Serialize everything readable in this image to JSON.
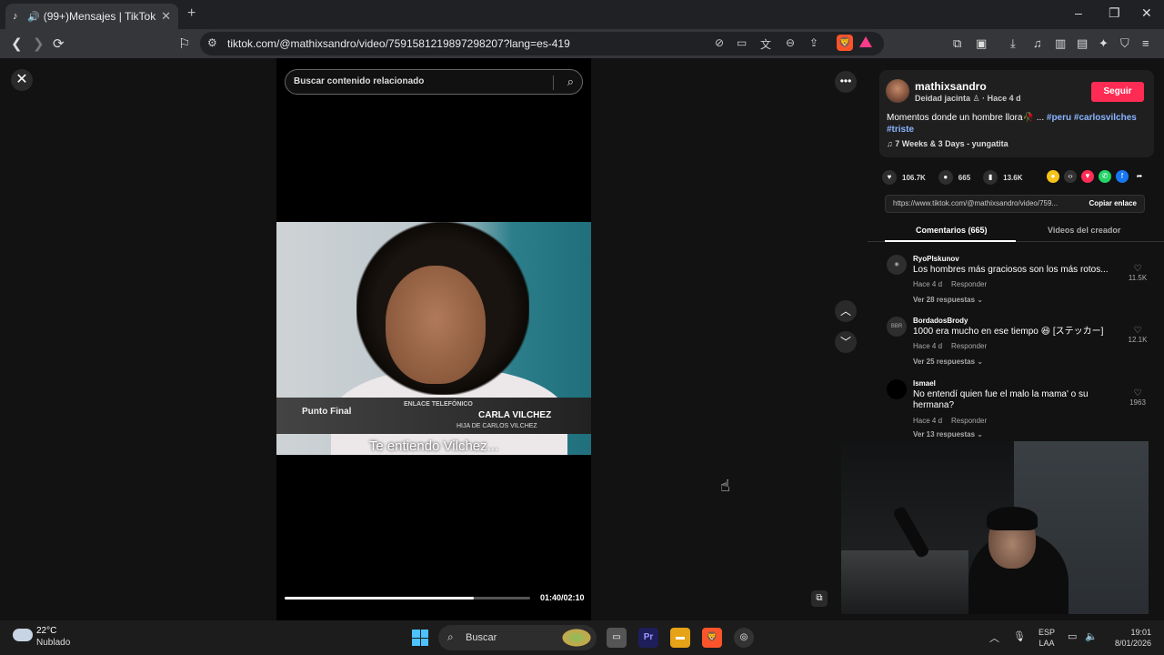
{
  "browser": {
    "tab_title": "(99+)Mensajes | TikTok",
    "url": "tiktok.com/@mathixsandro/video/7591581219897298207?lang=es-419",
    "tab_close": "✕",
    "new_tab": "+",
    "win_min": "–",
    "win_max": "❐",
    "win_close": "✕",
    "back": "❮",
    "forward": "❯",
    "reload": "⟳"
  },
  "player": {
    "search_placeholder": "Buscar contenido relacionado",
    "caption": "Te entiendo Vilchez...",
    "lower_third": {
      "logo": "Punto Final",
      "label": "ENLACE TELEFÓNICO",
      "name": "CARLA VILCHEZ",
      "subtitle": "HIJA DE CARLOS VILCHEZ"
    },
    "time": "01:40/02:10",
    "progress": 0.77
  },
  "post": {
    "author": "mathixsandro",
    "author_sub": "Deidad jacinta ♙ · Hace 4 d",
    "follow_label": "Seguir",
    "description": "Momentos donde un hombre llora🥀 ...",
    "tags": "#peru #carlosvilches #triste",
    "music": "♫ 7 Weeks & 3 Days - yungatita",
    "likes": "106.7K",
    "comments_count": "665",
    "saves": "13.6K",
    "link_url": "https://www.tiktok.com/@mathixsandro/video/759...",
    "copy_label": "Copiar enlace"
  },
  "tabs": {
    "comments": "Comentarios (665)",
    "creator_videos": "Videos del creador"
  },
  "comments": [
    {
      "user": "RyoPlskunov",
      "text": "Los hombres más graciosos son los más rotos...",
      "time": "Hace 4 d",
      "reply": "Responder",
      "replies": "Ver 28 respuestas ⌄",
      "likes": "11.5K"
    },
    {
      "user": "BordadosBrody",
      "text": "1000 era mucho en ese tiempo 😆 [ステッカー]",
      "time": "Hace 4 d",
      "reply": "Responder",
      "replies": "Ver 25 respuestas ⌄",
      "likes": "12.1K"
    },
    {
      "user": "Ismael",
      "text": "No entendí quien fue el malo la mama' o su hermana?",
      "time": "Hace 4 d",
      "reply": "Responder",
      "replies": "Ver 13 respuestas ⌄",
      "likes": "1963"
    }
  ],
  "taskbar": {
    "temp": "22°C",
    "weather": "Nublado",
    "search_label": "Buscar",
    "lang_top": "ESP",
    "lang_bottom": "LAA",
    "time": "19:01",
    "date": "8/01/2026"
  },
  "icons": {
    "close": "✕",
    "more": "•••",
    "up": "︿",
    "down": "﹀",
    "search": "⌕",
    "heart": "♥",
    "comment": "💬",
    "bookmark": "🔖",
    "cursor": "☝"
  }
}
